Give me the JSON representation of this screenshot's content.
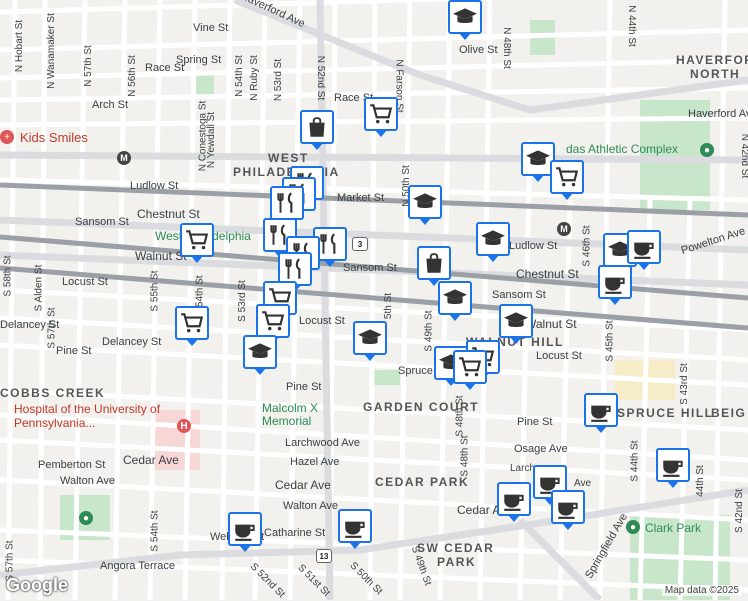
{
  "map": {
    "attribution": "Map data ©2025",
    "logo": "Google",
    "colors": {
      "land": "#f2f1ee",
      "road": "#ffffff",
      "arterial": "#dadce0",
      "rail": "#9aa0a6",
      "park": "#c8e6c9",
      "hospital": "#f7d6d6",
      "pin_border": "#1a73e8"
    }
  },
  "areas": [
    {
      "name": "HAVERFORD",
      "id": "haverford-north-1"
    },
    {
      "name": "NORTH",
      "id": "haverford-north-2"
    },
    {
      "name": "WEST",
      "id": "west-philadelphia-1"
    },
    {
      "name": "PHILADELPHIA",
      "id": "west-philadelphia-2"
    },
    {
      "name": "COBBS CREEK",
      "id": "cobbs-creek"
    },
    {
      "name": "GARDEN COURT",
      "id": "garden-court"
    },
    {
      "name": "CEDAR PARK",
      "id": "cedar-park"
    },
    {
      "name": "SW CEDAR",
      "id": "sw-cedar-1"
    },
    {
      "name": "PARK",
      "id": "sw-cedar-2"
    },
    {
      "name": "SPRUCE HILL",
      "id": "spruce-hill"
    },
    {
      "name": "BEIG",
      "id": "beig"
    },
    {
      "name": "WALNUT HILL",
      "id": "walnut-hill"
    }
  ],
  "streets": [
    "Vine St",
    "Haverford Ave",
    "Olive St",
    "Spring St",
    "Race St",
    "Race St",
    "Arch St",
    "Ludlow St",
    "Market St",
    "Chestnut St",
    "Chestnut St",
    "Sansom St",
    "Sansom St",
    "Sansom St",
    "Walnut St",
    "Walnut St",
    "Locust St",
    "Locust St",
    "Locust St",
    "Delancey St",
    "Delancey St",
    "Pine St",
    "Pine St",
    "Pine St",
    "Spruce St",
    "Larchwood Ave",
    "Osage Ave",
    "Hazel Ave",
    "Cedar Ave",
    "Cedar Ave",
    "Cedar Ave",
    "Pemberton St",
    "Walton Ave",
    "Walton Ave",
    "Catharine St",
    "Webster St",
    "Angora Terrace",
    "Springfield Ave",
    "Ludlow St",
    "Powelton Ave",
    "Haverford Ave",
    "N Hobart St",
    "N Wanamaker St",
    "N 57th St",
    "N 56th St",
    "N Conestoga St",
    "N Yewdall St",
    "N 54th St",
    "N Ruby St",
    "N 53rd St",
    "N 52nd St",
    "N 50th St",
    "N 48th St",
    "N 44th St",
    "N 42nd St",
    "S 58th St",
    "S Alden St",
    "S 57th St",
    "S 55th St",
    "S 54th St",
    "S 53rd St",
    "S 52nd St",
    "S 51st St",
    "S 50th St",
    "S 49th St",
    "S 48th St",
    "S 46th St",
    "S 45th St",
    "S 44th St",
    "S 43rd St",
    "S 42nd St",
    "S 57th St",
    "S 54th St",
    "N Farson St",
    "Larch",
    "Ave",
    "5th St",
    "44th St",
    "S 49th St",
    "S 48th St"
  ],
  "places": {
    "kids_smiles": "Kids Smiles",
    "hospital": "Hospital of the University of Pennsylvania...",
    "athletic": "das Athletic Complex",
    "malcolm": "Malcolm X Memorial",
    "clark": "Clark Park",
    "west_phila_station": "West Philadelphia"
  },
  "metro": [
    "M",
    "M"
  ],
  "route_shields": [
    "3",
    "13"
  ],
  "pins": [
    {
      "type": "school"
    },
    {
      "type": "shopping-cart"
    },
    {
      "type": "shopping-bag"
    },
    {
      "type": "school"
    },
    {
      "type": "shopping-cart"
    },
    {
      "type": "restaurant"
    },
    {
      "type": "restaurant"
    },
    {
      "type": "restaurant"
    },
    {
      "type": "school"
    },
    {
      "type": "school"
    },
    {
      "type": "shopping-cart"
    },
    {
      "type": "restaurant"
    },
    {
      "type": "restaurant"
    },
    {
      "type": "restaurant"
    },
    {
      "type": "restaurant"
    },
    {
      "type": "shopping-bag"
    },
    {
      "type": "school"
    },
    {
      "type": "shopping-cart"
    },
    {
      "type": "shopping-cart"
    },
    {
      "type": "shopping-cart"
    },
    {
      "type": "school"
    },
    {
      "type": "school"
    },
    {
      "type": "school"
    },
    {
      "type": "school"
    },
    {
      "type": "cafe"
    },
    {
      "type": "cafe"
    },
    {
      "type": "school"
    },
    {
      "type": "shopping-cart"
    },
    {
      "type": "shopping-cart"
    },
    {
      "type": "cafe"
    },
    {
      "type": "cafe"
    },
    {
      "type": "cafe"
    },
    {
      "type": "cafe"
    },
    {
      "type": "cafe"
    },
    {
      "type": "cafe"
    },
    {
      "type": "cafe"
    }
  ]
}
